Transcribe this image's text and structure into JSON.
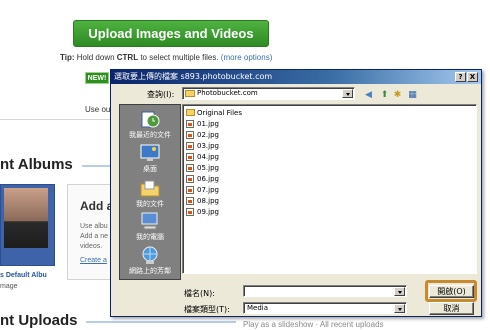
{
  "page": {
    "upload_button": "Upload Images and Videos",
    "tip_prefix": "Tip:",
    "tip_text": " Hold down ",
    "tip_key": "CTRL",
    "tip_suffix": " to select multiple files. ",
    "tip_more": "(more options)",
    "new_badge": "NEW!",
    "use_our": "Use ou",
    "section_albums": "nt Albums",
    "album_name": "s Default Albu",
    "album_count": "mage",
    "add_title": "Add a",
    "add_desc": [
      "Use albu",
      "Add a ne",
      "videos."
    ],
    "create_link": "Create a",
    "section_uploads": "nt Uploads",
    "slideshow_text": "Play as a slideshow · All recent uploads"
  },
  "dialog": {
    "title": "選取要上傳的檔案 s893.photobucket.com",
    "help_btn": "?",
    "close_btn": "X",
    "lookin_label": "查詢(I):",
    "lookin_value": "Photobucket.com",
    "places": [
      {
        "label": "我最近的文件",
        "icon": "recent-documents-icon"
      },
      {
        "label": "桌面",
        "icon": "desktop-icon"
      },
      {
        "label": "我的文件",
        "icon": "my-documents-icon"
      },
      {
        "label": "我的電腦",
        "icon": "my-computer-icon"
      },
      {
        "label": "網路上的芳鄰",
        "icon": "network-places-icon"
      }
    ],
    "folder": "Original Files",
    "files": [
      "01.jpg",
      "02.jpg",
      "03.jpg",
      "04.jpg",
      "05.jpg",
      "06.jpg",
      "07.jpg",
      "08.jpg",
      "09.jpg"
    ],
    "filename_label": "檔名(N):",
    "filename_value": "",
    "filetype_label": "檔案類型(T):",
    "filetype_value": "Media",
    "open_button": "開啟(O)",
    "cancel_button": "取消"
  },
  "colors": {
    "upload_green": "#2e8b23",
    "titlebar_blue": "#0a246a",
    "highlight_orange": "#c88a2e"
  }
}
